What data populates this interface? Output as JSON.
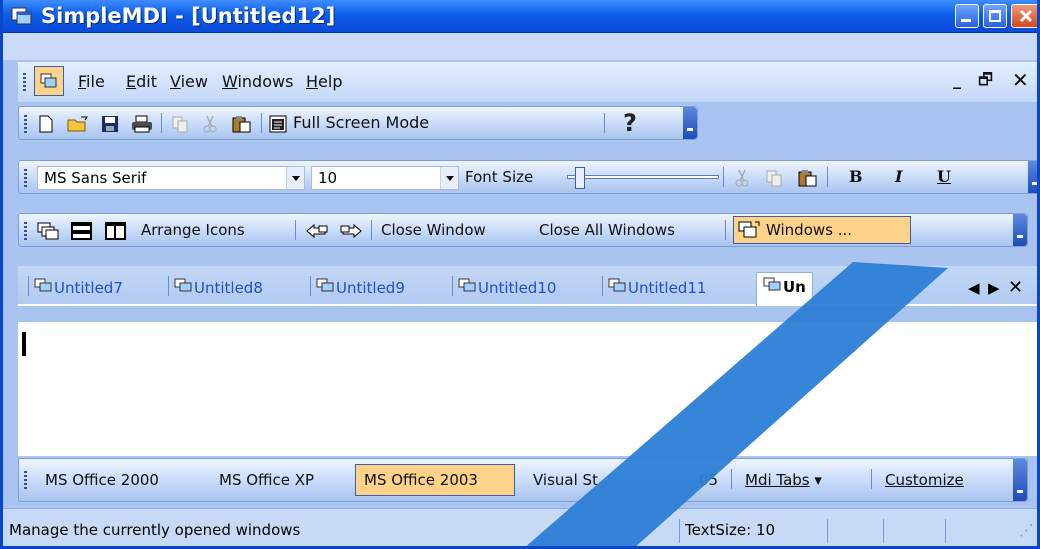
{
  "window": {
    "title": "SimpleMDI - [Untitled12]"
  },
  "menu": {
    "items": [
      "File",
      "Edit",
      "View",
      "Windows",
      "Help"
    ]
  },
  "toolbar1": {
    "full_screen": "Full Screen Mode"
  },
  "toolbar2": {
    "font_name": "MS Sans Serif",
    "font_size": "10",
    "font_size_label": "Font Size",
    "bold": "B",
    "italic": "I",
    "underline": "U"
  },
  "toolbar3": {
    "arrange_icons": "Arrange Icons",
    "close_window": "Close Window",
    "close_all": "Close All Windows",
    "windows": "Windows ..."
  },
  "tabs": [
    "Untitled7",
    "Untitled8",
    "Untitled9",
    "Untitled10",
    "Untitled11",
    "Un"
  ],
  "stylebar": {
    "items": [
      "MS Office 2000",
      "MS Office XP",
      "MS Office 2003",
      "Visual St"
    ],
    "item4_tail": "05",
    "mdi_tabs": "Mdi Tabs",
    "customize": "Customize"
  },
  "status": {
    "message": "Manage the currently opened windows",
    "text_size": "TextSize: 10"
  },
  "colors": {
    "title_blue": "#0a5de8",
    "bar_light": "#e3efff",
    "highlight": "#ffd28a",
    "tab_text": "#1e50c8",
    "overlay": "#2c7ed6"
  }
}
